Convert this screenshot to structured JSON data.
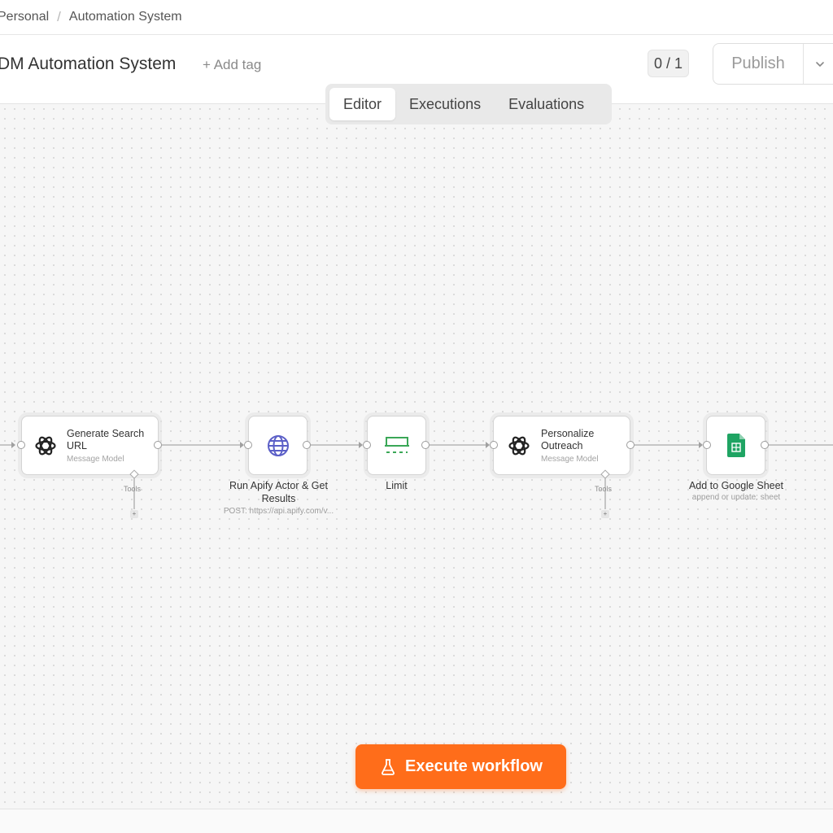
{
  "breadcrumb": {
    "workspace": "Personal",
    "separator": "/",
    "project": "Automation System"
  },
  "header": {
    "workflow_name": "DM Automation System",
    "add_tag_label": "+ Add tag",
    "version_badge": "0 / 1",
    "publish_label": "Publish"
  },
  "tabs": [
    {
      "label": "Editor",
      "active": true
    },
    {
      "label": "Executions",
      "active": false
    },
    {
      "label": "Evaluations",
      "active": false
    }
  ],
  "nodes": {
    "generate": {
      "title": "Generate Search URL",
      "subtitle": "Message Model",
      "tools_label": "Tools",
      "icon": "openai-icon"
    },
    "apify": {
      "label": "Run Apify Actor & Get Results",
      "sublabel": "POST: https://api.apify.com/v...",
      "icon": "globe-icon"
    },
    "limit": {
      "label": "Limit",
      "icon": "limit-icon"
    },
    "personalize": {
      "title": "Personalize Outreach",
      "subtitle": "Message Model",
      "tools_label": "Tools",
      "icon": "openai-icon"
    },
    "sheet": {
      "label": "Add to Google Sheet",
      "sublabel": "append or update: sheet",
      "icon": "google-sheets-icon"
    }
  },
  "execute_label": "Execute workflow",
  "colors": {
    "accent": "#ff6d1a",
    "globe": "#5b5fc7",
    "limit": "#3aa757",
    "sheets": "#1fa463"
  }
}
